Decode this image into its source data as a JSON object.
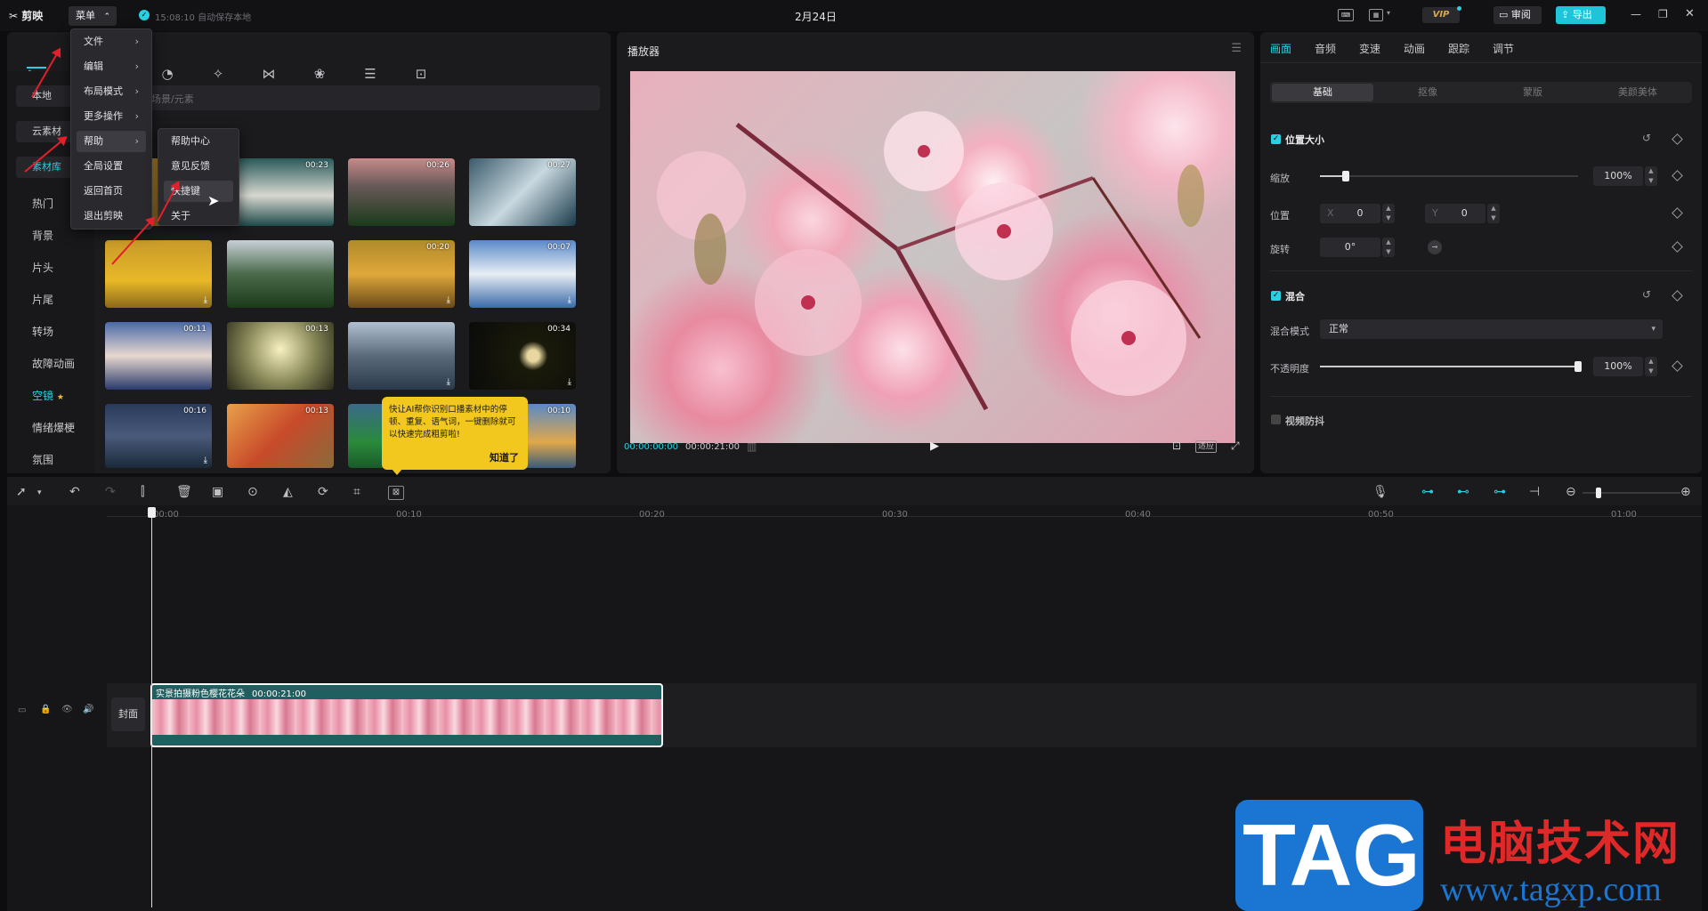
{
  "app": {
    "logo_label": "剪映",
    "menu_button": "菜单",
    "autosave": "15:08:10 自动保存本地",
    "project_title": "2月24日",
    "vip": "VIP",
    "review_label": "审阅",
    "export_label": "导出"
  },
  "media_tabs": [
    {
      "label": "媒体",
      "icon": "media-icon"
    },
    {
      "label": "贴纸",
      "icon": "sticker-icon"
    },
    {
      "label": "特效",
      "icon": "effects-icon"
    },
    {
      "label": "转场",
      "icon": "transition-icon"
    },
    {
      "label": "滤镜",
      "icon": "filter-icon"
    },
    {
      "label": "调节",
      "icon": "adjust-icon"
    },
    {
      "label": "模板",
      "icon": "template-icon"
    }
  ],
  "sidebar": {
    "local": "本地",
    "cloud": "云素材",
    "library": "素材库",
    "items": [
      "热门",
      "背景",
      "片头",
      "片尾",
      "转场",
      "故障动画",
      "空镜",
      "情绪爆梗",
      "氛围"
    ]
  },
  "search": {
    "placeholder": "搜索场景/元素"
  },
  "thumbnails": [
    {
      "duration": "00:23",
      "download": false
    },
    {
      "duration": "00:26",
      "download": false
    },
    {
      "duration": "00:27",
      "download": false
    },
    {
      "duration": "",
      "download": true
    },
    {
      "duration": "",
      "download": false
    },
    {
      "duration": "00:20",
      "download": true
    },
    {
      "duration": "00:07",
      "download": true
    },
    {
      "duration": "00:11",
      "download": false
    },
    {
      "duration": "00:13",
      "download": false
    },
    {
      "duration": "",
      "download": true
    },
    {
      "duration": "00:34",
      "download": true
    },
    {
      "duration": "00:16",
      "download": true
    },
    {
      "duration": "00:13",
      "download": false
    },
    {
      "duration": "00:10",
      "download": false
    }
  ],
  "menu": {
    "items": [
      "文件",
      "编辑",
      "布局模式",
      "更多操作",
      "帮助",
      "全局设置",
      "返回首页",
      "退出剪映"
    ],
    "submenu": [
      "帮助中心",
      "意见反馈",
      "快捷键",
      "关于"
    ]
  },
  "tooltip": {
    "text": "快让AI帮你识别口播素材中的停顿、重复、语气词，一键删除就可以快速完成粗剪啦!",
    "button": "知道了"
  },
  "player": {
    "title": "播放器",
    "current_time": "00:00:00:00",
    "total_time": "00:00:21:00",
    "fit_label": "适应"
  },
  "props": {
    "tabs": [
      "画面",
      "音频",
      "变速",
      "动画",
      "跟踪",
      "调节"
    ],
    "subtabs": [
      "基础",
      "抠像",
      "蒙版",
      "美颜美体"
    ],
    "position_size": "位置大小",
    "scale_label": "缩放",
    "scale_value": "100%",
    "scale_level": 0.1,
    "position_label": "位置",
    "x_label": "X",
    "x_value": "0",
    "y_label": "Y",
    "y_value": "0",
    "rotate_label": "旋转",
    "rotate_value": "0°",
    "blend": "混合",
    "blend_mode_label": "混合模式",
    "blend_mode_value": "正常",
    "opacity_label": "不透明度",
    "opacity_value": "100%",
    "opacity_level": 1.0,
    "stabilize": "视频防抖"
  },
  "timeline": {
    "ticks": [
      "00:00",
      "00:10",
      "00:20",
      "00:30",
      "00:40",
      "00:50",
      "01:00"
    ],
    "cover_label": "封面",
    "clip_name": "实景拍摄粉色樱花花朵",
    "clip_duration": "00:00:21:00"
  },
  "watermark": {
    "tag": "TAG",
    "site_cn": "电脑技术网",
    "site_url": "www.tagxp.com"
  }
}
